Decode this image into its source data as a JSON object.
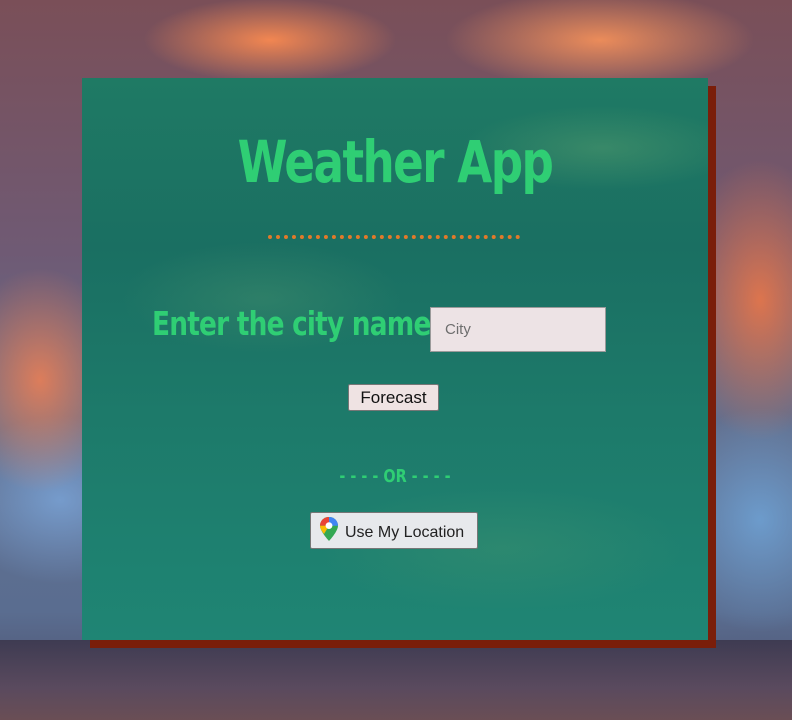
{
  "app": {
    "title": "Weather App"
  },
  "search": {
    "label": "Enter the city name",
    "placeholder": "City",
    "value": ""
  },
  "forecast_button": {
    "label": "Forecast"
  },
  "separator": {
    "text": "- - - - OR - - - -"
  },
  "location_button": {
    "label": "Use My Location",
    "icon": "map-pin-icon"
  },
  "colors": {
    "title": "#2fce74",
    "divider": "#e07a2a",
    "card": "#1f7a64",
    "card_shadow": "#7a1e0a"
  }
}
